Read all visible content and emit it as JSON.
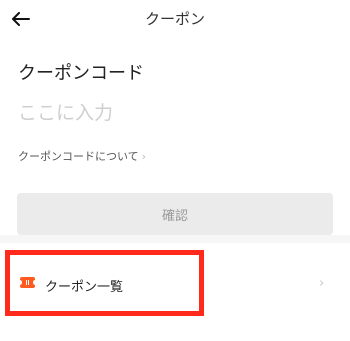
{
  "header": {
    "back_icon": "arrow-left-icon",
    "title": "クーポン"
  },
  "form": {
    "section_title": "クーポンコード",
    "code_placeholder": "ここに入力",
    "code_value": "",
    "about_link_label": "クーポンコードについて",
    "about_chevron": "›"
  },
  "confirm_button": {
    "label": "確認"
  },
  "coupon_list_row": {
    "icon": "ticket-icon",
    "label": "クーポン一覧",
    "chevron": "›"
  },
  "colors": {
    "accent": "#ff5a1f",
    "highlight_border": "#ff2a1b",
    "placeholder": "#cfcfcf",
    "button_bg": "#ebebeb"
  }
}
